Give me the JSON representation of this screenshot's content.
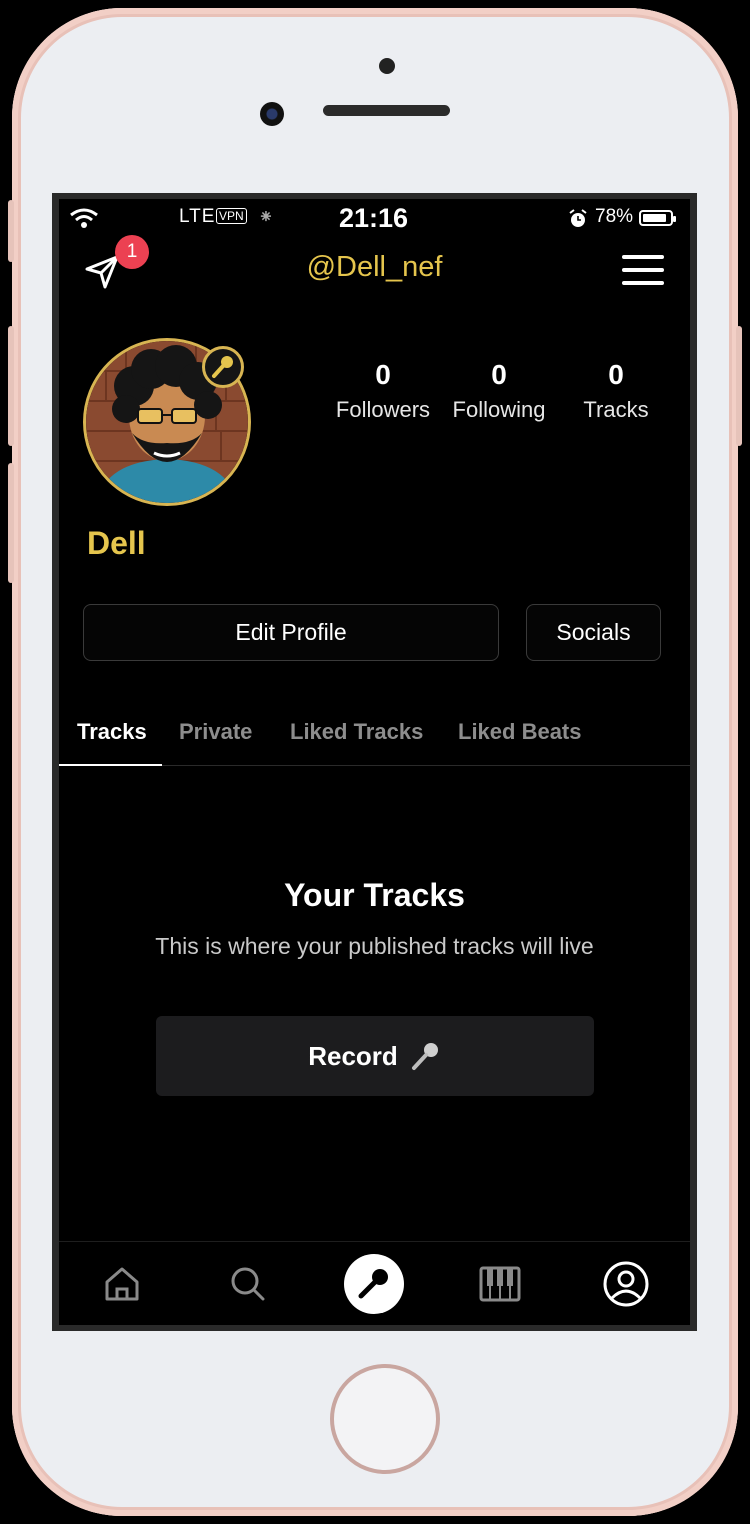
{
  "status_bar": {
    "carrier": "LTE",
    "vpn": "VPN",
    "time": "21:16",
    "battery": "78%",
    "spinner": "⁕",
    "alarm_icon": "alarm-icon"
  },
  "header": {
    "username": "@Dell_nef",
    "notification_count": "1"
  },
  "profile": {
    "display_name": "Dell",
    "stats": [
      {
        "value": "0",
        "label": "Followers"
      },
      {
        "value": "0",
        "label": "Following"
      },
      {
        "value": "0",
        "label": "Tracks"
      }
    ]
  },
  "actions": {
    "edit_profile": "Edit Profile",
    "socials": "Socials"
  },
  "tabs": [
    {
      "label": "Tracks",
      "active": true
    },
    {
      "label": "Private",
      "active": false
    },
    {
      "label": "Liked Tracks",
      "active": false
    },
    {
      "label": "Liked Beats",
      "active": false
    }
  ],
  "empty_state": {
    "title": "Your Tracks",
    "subtitle": "This is where your published tracks will live",
    "record_label": "Record"
  },
  "bottom_nav": [
    "home-icon",
    "search-icon",
    "microphone-icon",
    "piano-icon",
    "profile-icon"
  ],
  "colors": {
    "accent": "#e5c54d",
    "background": "#000000",
    "badge": "#ec4152",
    "button_bg": "#1c1c1e"
  }
}
